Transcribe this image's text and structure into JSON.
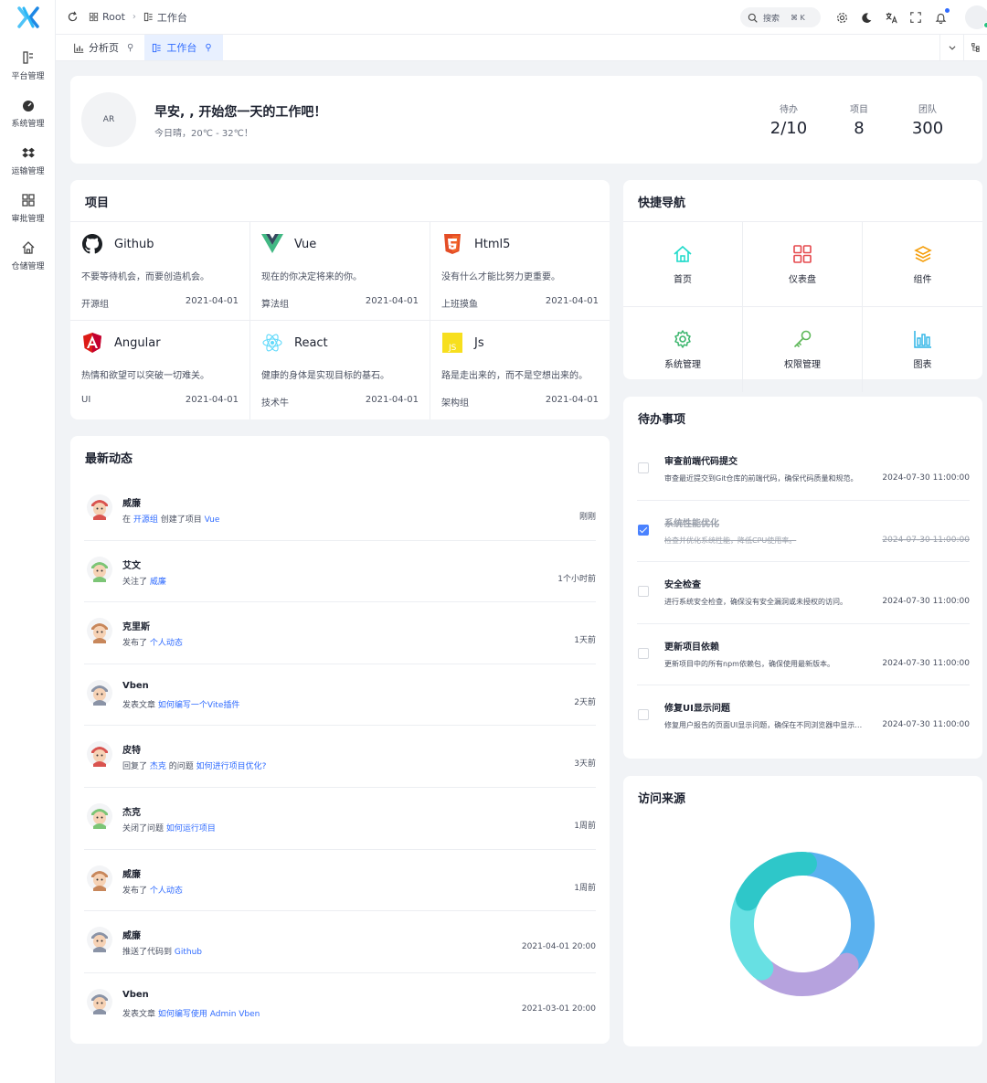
{
  "sidebar": {
    "items": [
      {
        "label": "平台管理",
        "icon": "platform-icon"
      },
      {
        "label": "系统管理",
        "icon": "dashboard-gauge-icon"
      },
      {
        "label": "运输管理",
        "icon": "dropbox-icon"
      },
      {
        "label": "审批管理",
        "icon": "grid-icon"
      },
      {
        "label": "仓储管理",
        "icon": "home-icon"
      }
    ]
  },
  "header": {
    "breadcrumb": [
      "Root",
      "工作台"
    ],
    "search_placeholder": "搜索",
    "search_shortcut": "⌘ K",
    "avatar_label": ""
  },
  "tabs": [
    {
      "label": "分析页",
      "active": false
    },
    {
      "label": "工作台",
      "active": true
    }
  ],
  "welcome": {
    "avatar_text": "AR",
    "greeting": "早安, , 开始您一天的工作吧！",
    "weather": "今日晴，20℃ - 32℃！",
    "stats": [
      {
        "label": "待办",
        "value": "2/10"
      },
      {
        "label": "项目",
        "value": "8"
      },
      {
        "label": "团队",
        "value": "300"
      }
    ]
  },
  "projects": {
    "title": "项目",
    "items": [
      {
        "name": "Github",
        "icon": "github-icon",
        "desc": "不要等待机会，而要创造机会。",
        "group": "开源组",
        "date": "2021-04-01"
      },
      {
        "name": "Vue",
        "icon": "vue-icon",
        "desc": "现在的你决定将来的你。",
        "group": "算法组",
        "date": "2021-04-01"
      },
      {
        "name": "Html5",
        "icon": "html5-icon",
        "desc": "没有什么才能比努力更重要。",
        "group": "上班摸鱼",
        "date": "2021-04-01"
      },
      {
        "name": "Angular",
        "icon": "angular-icon",
        "desc": "热情和欲望可以突破一切难关。",
        "group": "UI",
        "date": "2021-04-01"
      },
      {
        "name": "React",
        "icon": "react-icon",
        "desc": "健康的身体是实现目标的基石。",
        "group": "技术牛",
        "date": "2021-04-01"
      },
      {
        "name": "Js",
        "icon": "js-icon",
        "desc": "路是走出来的，而不是空想出来的。",
        "group": "架构组",
        "date": "2021-04-01"
      }
    ]
  },
  "activities": {
    "title": "最新动态",
    "items": [
      {
        "name": "威廉",
        "pre": "在 ",
        "link1": "开源组",
        "mid": " 创建了项目 ",
        "link2": "Vue",
        "time": "刚刚"
      },
      {
        "name": "艾文",
        "pre": "关注了 ",
        "link1": "威廉",
        "mid": "",
        "link2": "",
        "time": "1个小时前"
      },
      {
        "name": "克里斯",
        "pre": "发布了 ",
        "link1": "个人动态",
        "mid": "",
        "link2": "",
        "time": "1天前"
      },
      {
        "name": "Vben",
        "pre": "发表文章 ",
        "link1": "如何编写一个Vite插件",
        "mid": "",
        "link2": "",
        "time": "2天前"
      },
      {
        "name": "皮特",
        "pre": "回复了 ",
        "link1": "杰克",
        "mid": " 的问题 ",
        "link2": "如何进行项目优化?",
        "time": "3天前"
      },
      {
        "name": "杰克",
        "pre": "关闭了问题 ",
        "link1": "如何运行项目",
        "mid": "",
        "link2": "",
        "time": "1周前"
      },
      {
        "name": "威廉",
        "pre": "发布了 ",
        "link1": "个人动态",
        "mid": "",
        "link2": "",
        "time": "1周前"
      },
      {
        "name": "威廉",
        "pre": "推送了代码到 ",
        "link1": "Github",
        "mid": "",
        "link2": "",
        "time": "2021-04-01 20:00"
      },
      {
        "name": "Vben",
        "pre": "发表文章 ",
        "link1": "如何编写使用 Admin Vben",
        "mid": "",
        "link2": "",
        "time": "2021-03-01 20:00"
      }
    ]
  },
  "quicknav": {
    "title": "快捷导航",
    "items": [
      {
        "label": "首页",
        "icon": "home-icon",
        "color": "#1fdaca"
      },
      {
        "label": "仪表盘",
        "icon": "dashboard-icon",
        "color": "#e5484d"
      },
      {
        "label": "组件",
        "icon": "layers-icon",
        "color": "#f59e0b"
      },
      {
        "label": "系统管理",
        "icon": "settings-icon",
        "color": "#3ab56c"
      },
      {
        "label": "权限管理",
        "icon": "key-icon",
        "color": "#5fb85a"
      },
      {
        "label": "图表",
        "icon": "chart-icon",
        "color": "#2bb4e6"
      }
    ]
  },
  "todos": {
    "title": "待办事项",
    "items": [
      {
        "title": "审查前端代码提交",
        "desc": "审查最近提交到Git仓库的前端代码，确保代码质量和规范。",
        "date": "2024-07-30 11:00:00",
        "done": false
      },
      {
        "title": "系统性能优化",
        "desc": "检查并优化系统性能，降低CPU使用率。",
        "date": "2024-07-30 11:00:00",
        "done": true
      },
      {
        "title": "安全检查",
        "desc": "进行系统安全检查，确保没有安全漏洞或未授权的访问。",
        "date": "2024-07-30 11:00:00",
        "done": false
      },
      {
        "title": "更新项目依赖",
        "desc": "更新项目中的所有npm依赖包，确保使用最新版本。",
        "date": "2024-07-30 11:00:00",
        "done": false
      },
      {
        "title": "修复UI显示问题",
        "desc": "修复用户报告的页面UI显示问题，确保在不同浏览器中显示正常。",
        "date": "2024-07-30 11:00:00",
        "done": false
      }
    ]
  },
  "traffic": {
    "title": "访问来源"
  },
  "chart_data": {
    "type": "pie",
    "title": "访问来源",
    "donut": true,
    "slices": [
      {
        "value": 35,
        "color": "#5ab1ef"
      },
      {
        "value": 25,
        "color": "#b6a2de"
      },
      {
        "value": 20,
        "color": "#67e0e3"
      },
      {
        "value": 20,
        "color": "#2ec7c9"
      }
    ]
  },
  "colors": {
    "accent": "#2f6bff",
    "link": "#2f6bff"
  }
}
